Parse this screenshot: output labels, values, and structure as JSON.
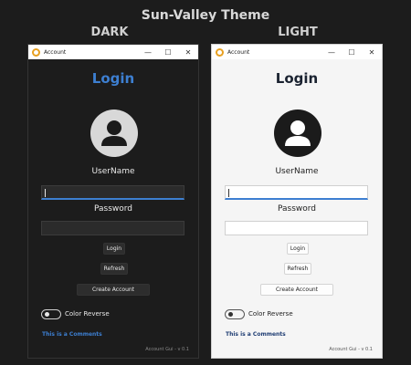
{
  "header": {
    "title": "Sun-Valley Theme"
  },
  "themes": {
    "dark": {
      "label": "DARK",
      "window_title": "Account",
      "login_title": "Login",
      "username_label": "UserName",
      "password_label": "Password",
      "login_button": "Login",
      "refresh_button": "Refresh",
      "create_button": "Create Account",
      "toggle_label": "Color Reverse",
      "comment": "This is a Comments",
      "version": "Account Gui - v 0.1"
    },
    "light": {
      "label": "LIGHT",
      "window_title": "Account",
      "login_title": "Login",
      "username_label": "UserName",
      "password_label": "Password",
      "login_button": "Login",
      "refresh_button": "Refresh",
      "create_button": "Create Account",
      "toggle_label": "Color Reverse",
      "comment": "This is a Comments",
      "version": "Account Gui - v 0.1"
    }
  },
  "window_controls": {
    "minimize": "—",
    "maximize": "☐",
    "close": "✕"
  },
  "icons": {
    "app": "account-app-icon",
    "avatar": "user-avatar-icon"
  },
  "colors": {
    "accent": "#3d7fd1",
    "dark_bg": "#1c1c1c",
    "light_bg": "#f5f5f5"
  },
  "toggle_state": {
    "dark": "off",
    "light": "off"
  }
}
